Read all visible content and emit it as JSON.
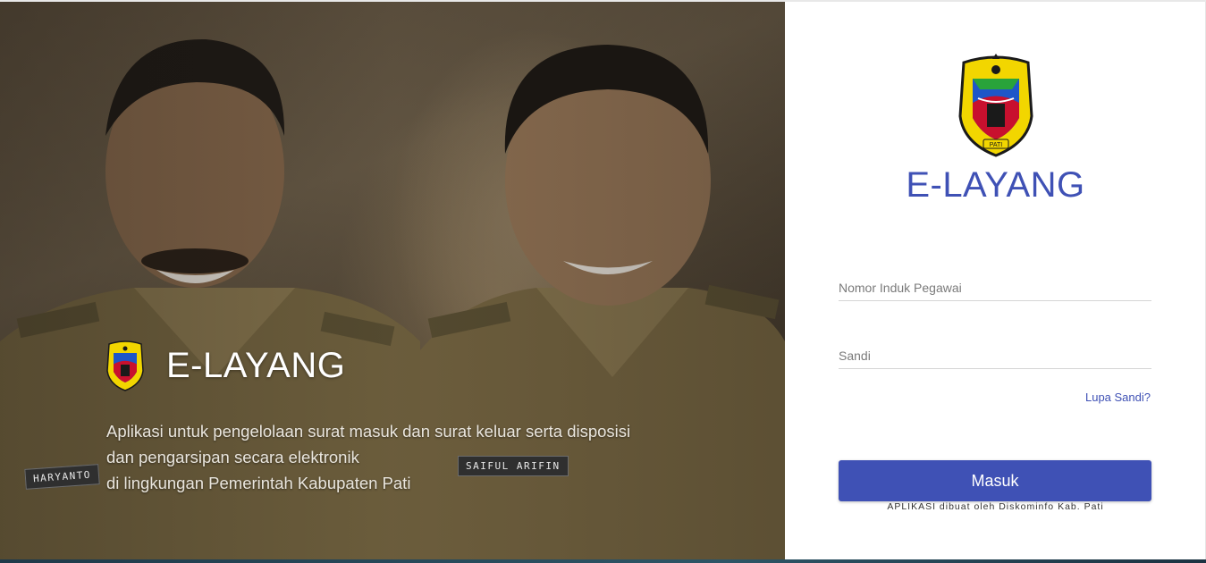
{
  "app": {
    "title": "E-LAYANG"
  },
  "hero": {
    "title": "E-LAYANG",
    "description_lines": [
      "Aplikasi untuk pengelolaan surat masuk dan surat keluar serta disposisi",
      "dan pengarsipan secara elektronik",
      "di lingkungan Pemerintah Kabupaten Pati"
    ],
    "name_tags": [
      "HARYANTO",
      "SAIFUL ARIFIN"
    ]
  },
  "login": {
    "nip_placeholder": "Nomor Induk Pegawai",
    "password_placeholder": "Sandi",
    "forgot_label": "Lupa Sandi?",
    "submit_label": "Masuk",
    "credit": "APLIKASI dibuat oleh Diskominfo Kab. Pati"
  },
  "crest": {
    "label": "PATI"
  },
  "colors": {
    "accent": "#3f51b5",
    "crest_yellow": "#f2d600",
    "crest_red": "#c8102e",
    "crest_blue": "#1e56c8"
  }
}
